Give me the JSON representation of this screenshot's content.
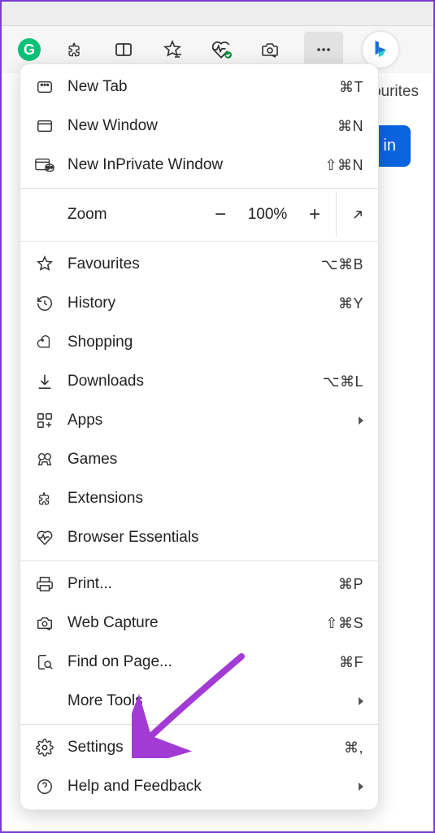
{
  "toolbar": {
    "icons": {
      "grammarly": "G",
      "extensions": "extensions-icon",
      "split": "split-screen-icon",
      "favourites": "favourites-star-icon",
      "essentials": "heart-pulse-icon",
      "capture": "camera-icon",
      "more": "more-icon",
      "bing": "bing-icon"
    }
  },
  "background": {
    "favourites_tab": "ourites",
    "signin_partial": "in"
  },
  "menu": {
    "new_tab": {
      "label": "New Tab",
      "shortcut": "⌘T"
    },
    "new_window": {
      "label": "New Window",
      "shortcut": "⌘N"
    },
    "new_inprivate": {
      "label": "New InPrivate Window",
      "shortcut": "⇧⌘N"
    },
    "zoom": {
      "label": "Zoom",
      "percent": "100%"
    },
    "favourites": {
      "label": "Favourites",
      "shortcut": "⌥⌘B"
    },
    "history": {
      "label": "History",
      "shortcut": "⌘Y"
    },
    "shopping": {
      "label": "Shopping"
    },
    "downloads": {
      "label": "Downloads",
      "shortcut": "⌥⌘L"
    },
    "apps": {
      "label": "Apps"
    },
    "games": {
      "label": "Games"
    },
    "extensions": {
      "label": "Extensions"
    },
    "essentials": {
      "label": "Browser Essentials"
    },
    "print": {
      "label": "Print...",
      "shortcut": "⌘P"
    },
    "web_capture": {
      "label": "Web Capture",
      "shortcut": "⇧⌘S"
    },
    "find": {
      "label": "Find on Page...",
      "shortcut": "⌘F"
    },
    "more_tools": {
      "label": "More Tools"
    },
    "settings": {
      "label": "Settings",
      "shortcut": "⌘,"
    },
    "help": {
      "label": "Help and Feedback"
    }
  },
  "annotation": {
    "color": "#a23bd4"
  }
}
